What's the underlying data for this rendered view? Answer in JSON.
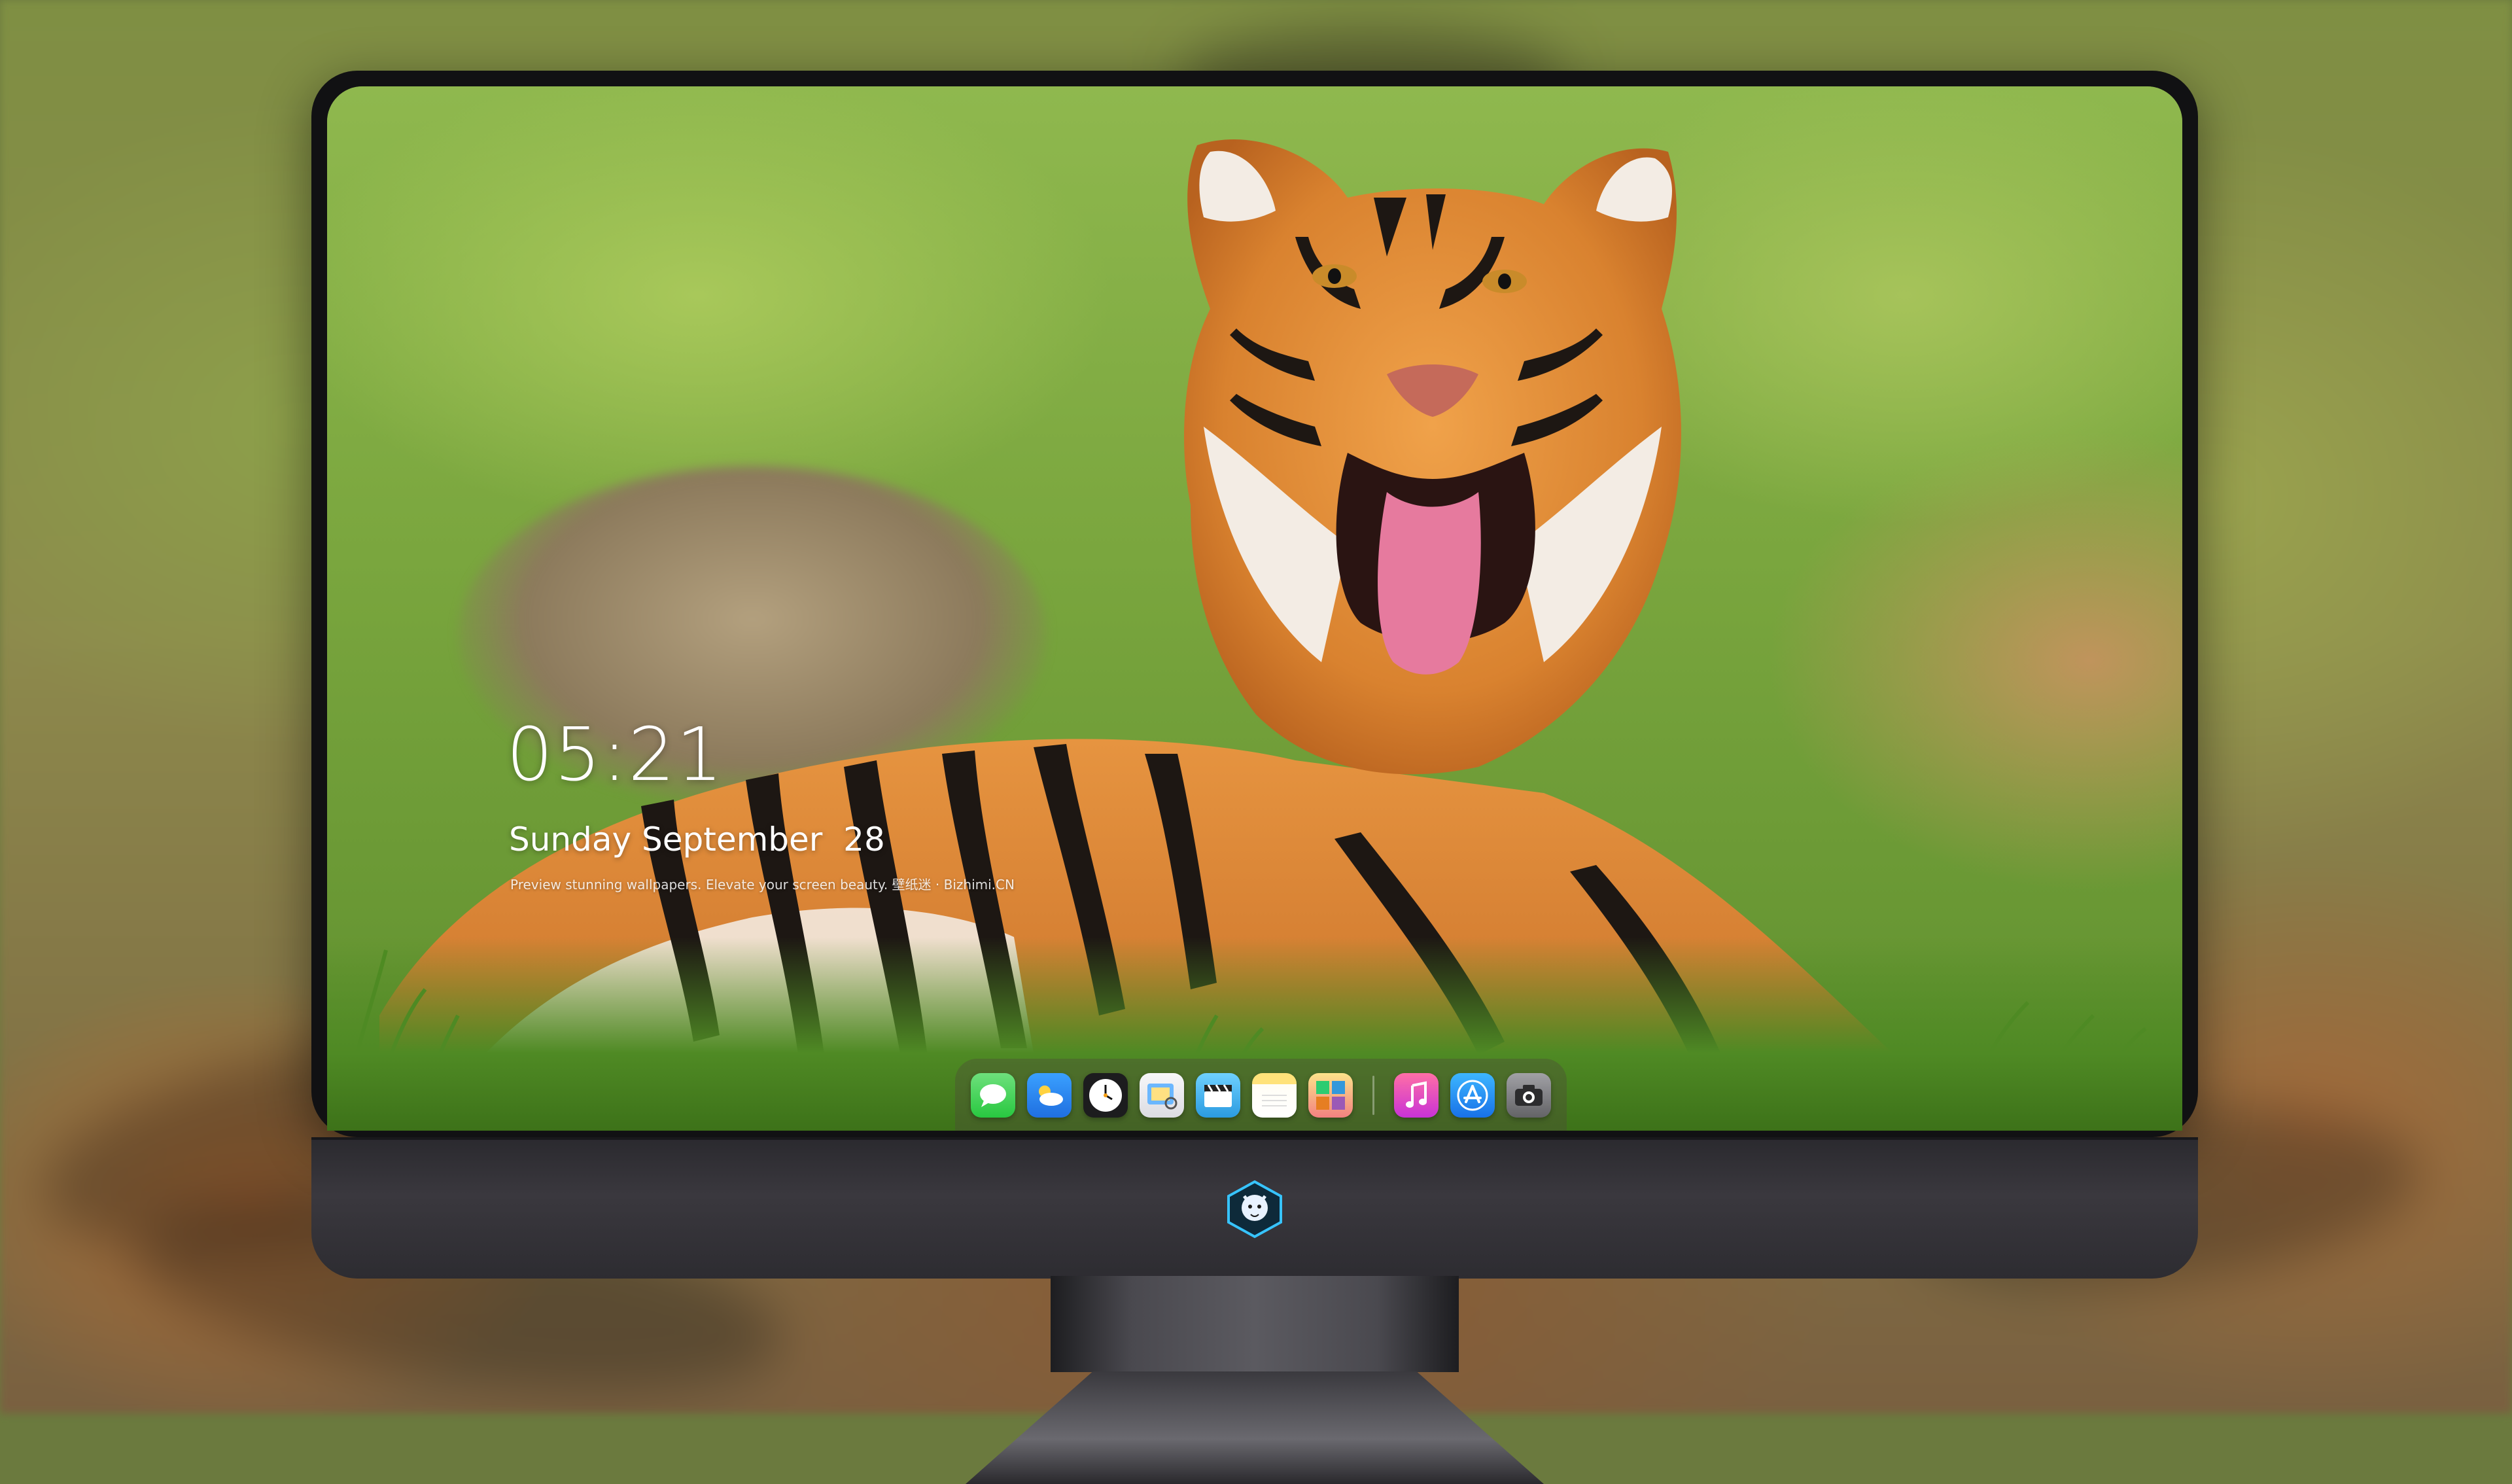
{
  "lockscreen": {
    "time": "05:21",
    "date": "Sunday September  28",
    "tagline": "Preview stunning wallpapers. Elevate your screen beauty. 壁纸迷 · Bizhimi.CN"
  },
  "wallpaper": {
    "colors": {
      "grass": "#8fb84e",
      "tiger_orange": "#d9822f",
      "tiger_stripe": "#1d1713",
      "tongue": "#e67a9e"
    }
  },
  "dock": {
    "apps": [
      {
        "name": "messages-icon",
        "color": "#34c759"
      },
      {
        "name": "weather-icon",
        "color": "#2f8cf5"
      },
      {
        "name": "clock-icon",
        "color": "#1c1c1e"
      },
      {
        "name": "preview-icon",
        "color": "#f5f5f7"
      },
      {
        "name": "claquette-icon",
        "color": "#3aa7e3"
      },
      {
        "name": "notes-icon",
        "color": "#fde27a"
      },
      {
        "name": "photo-booth-icon",
        "color": "#f6d26b"
      },
      {
        "name": "music-icon",
        "color": "#f64d8f"
      },
      {
        "name": "app-store-icon",
        "color": "#2b8cf4"
      },
      {
        "name": "camera-icon",
        "color": "#8e8e93"
      }
    ]
  },
  "monitor": {
    "logo": "badge-logo-icon"
  }
}
